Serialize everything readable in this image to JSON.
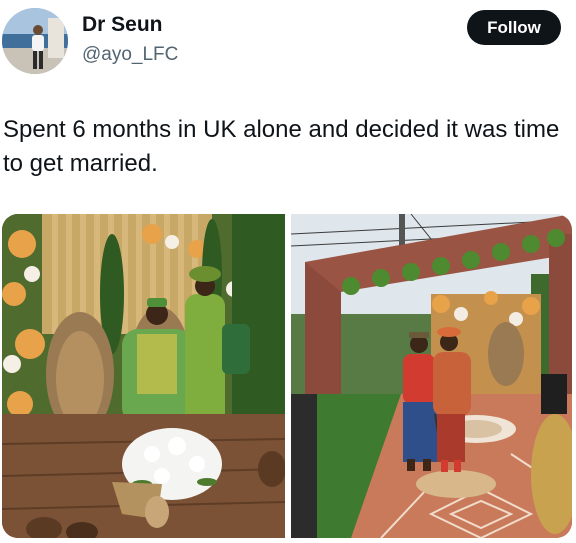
{
  "author": {
    "display_name": "Dr Seun",
    "handle": "@ayo_LFC",
    "avatar_icon": "profile-photo"
  },
  "follow_button": {
    "label": "Follow"
  },
  "tweet": {
    "text": "Spent 6 months in UK alone and decided it was time to get married."
  },
  "media": [
    {
      "name": "wedding-photo-seated-couple",
      "icon": "photo"
    },
    {
      "name": "wedding-photo-standing-couple",
      "icon": "photo"
    }
  ],
  "colors": {
    "text_primary": "#0f1419",
    "text_secondary": "#536471",
    "follow_button_bg": "#0f1419",
    "follow_button_text": "#ffffff"
  }
}
